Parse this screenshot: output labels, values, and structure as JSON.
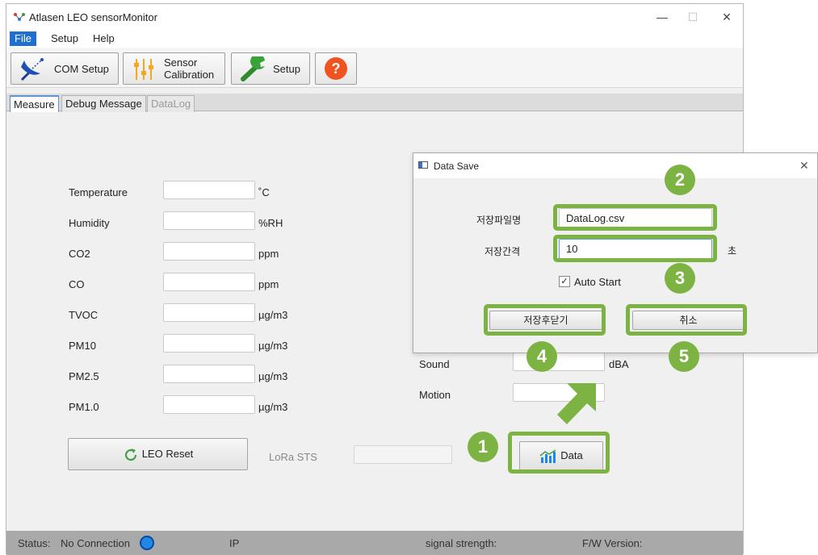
{
  "window": {
    "title": "Atlasen LEO sensorMonitor",
    "controls": {
      "minimize": "—",
      "maximize": "☐",
      "close": "✕"
    }
  },
  "menu": {
    "file": "File",
    "setup": "Setup",
    "help": "Help"
  },
  "toolbar": {
    "com_setup": "COM Setup",
    "sensor_cal_line1": "Sensor",
    "sensor_cal_line2": "Calibration",
    "setup": "Setup",
    "help": "?"
  },
  "tabs": {
    "measure": "Measure",
    "debug": "Debug Message",
    "datalog": "DataLog"
  },
  "measure": {
    "rows": [
      {
        "label": "Temperature",
        "unit": "˚C"
      },
      {
        "label": "Humidity",
        "unit": "%RH"
      },
      {
        "label": "CO2",
        "unit": "ppm"
      },
      {
        "label": "CO",
        "unit": "ppm"
      },
      {
        "label": "TVOC",
        "unit": "µg/m3"
      },
      {
        "label": "PM10",
        "unit": "µg/m3"
      },
      {
        "label": "PM2.5",
        "unit": "µg/m3"
      },
      {
        "label": "PM1.0",
        "unit": "µg/m3"
      }
    ],
    "sound_label": "Sound",
    "sound_unit": "dBA",
    "motion_label": "Motion",
    "leo_reset": "LEO Reset",
    "lora_sts": "LoRa STS",
    "data_button": "Data"
  },
  "dialog": {
    "title": "Data Save",
    "close": "✕",
    "filename_label": "저장파일명",
    "filename_value": "DataLog.csv",
    "interval_label": "저장간격",
    "interval_value": "10",
    "interval_unit": "초",
    "auto_start_label": "Auto Start",
    "auto_start_checked": true,
    "save_close_button": "저장후닫기",
    "cancel_button": "취소"
  },
  "callouts": [
    "1",
    "2",
    "3",
    "4",
    "5"
  ],
  "status": {
    "status_label": "Status:",
    "connection": "No Connection",
    "ip_label": "IP",
    "signal_label": "signal strength:",
    "fw_label": "F/W Version:"
  },
  "colors": {
    "highlight": "#7cb342",
    "menu_active": "#1f6fd1",
    "status_bar": "#a9a9a9",
    "tab_active_border": "#5b93d6"
  }
}
